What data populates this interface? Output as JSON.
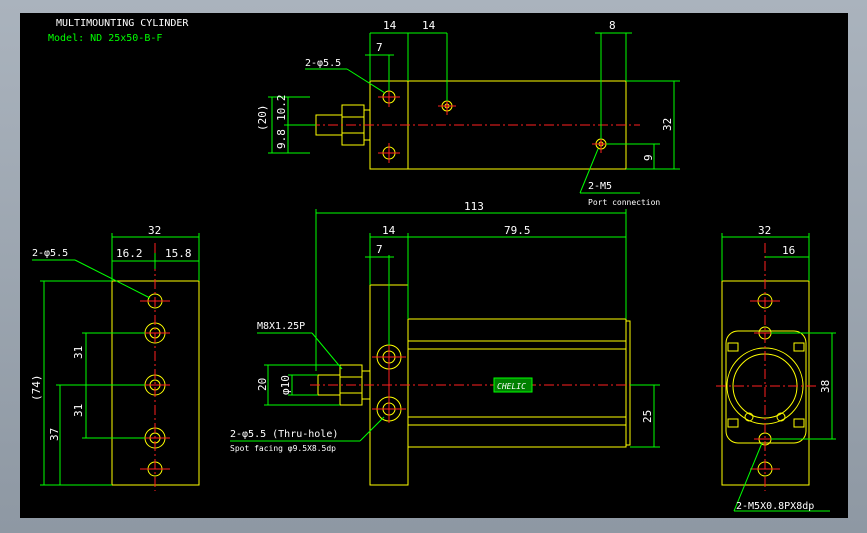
{
  "title": {
    "line1": "MULTIMOUNTING CYLINDER",
    "line2": "Model: ND 25x50-B-F"
  },
  "top_view": {
    "dim_14a": "14",
    "dim_14b": "14",
    "dim_8": "8",
    "dim_7": "7",
    "hole_label": "2-φ5.5",
    "dim_20": "(20)",
    "dim_10_2": "10.2",
    "dim_9_8": "9.8",
    "dim_32": "32",
    "dim_9": "9",
    "port_label": "2-M5",
    "port_note": "Port connection"
  },
  "left_view": {
    "dim_32": "32",
    "dim_16_2": "16.2",
    "dim_15_8": "15.8",
    "hole_label": "2-φ5.5",
    "dim_74": "(74)",
    "dim_31a": "31",
    "dim_31b": "31",
    "dim_37": "37"
  },
  "front_view": {
    "dim_113": "113",
    "dim_14": "14",
    "dim_79_5": "79.5",
    "dim_7": "7",
    "thread_label": "M8X1.25P",
    "dim_20": "20",
    "dim_phi10": "φ10",
    "dim_25": "25",
    "hole_label": "2-φ5.5 (Thru-hole)",
    "spot_note": "Spot facing  φ9.5X8.5dp",
    "logo_text": "CHELIC"
  },
  "right_view": {
    "dim_32": "32",
    "dim_16": "16",
    "dim_38": "38",
    "tap_label": "2-M5X0.8PX8dp"
  }
}
